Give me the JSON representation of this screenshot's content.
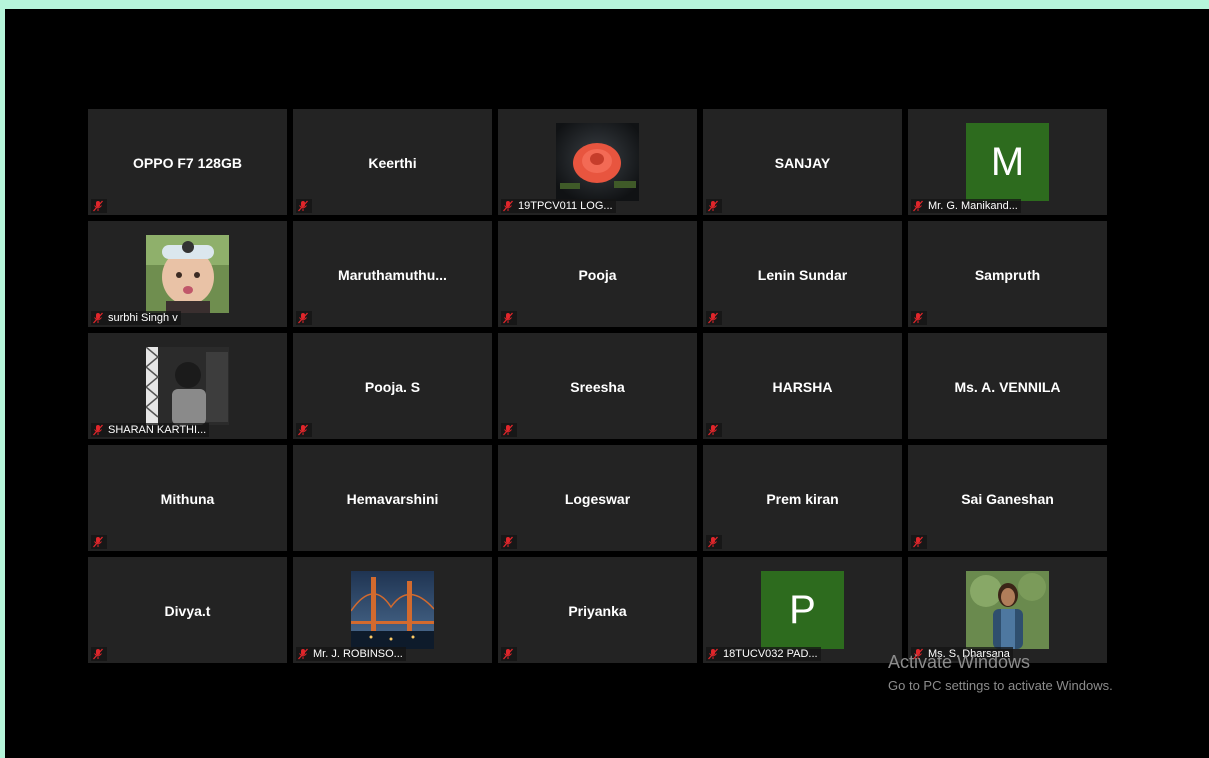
{
  "meeting": {
    "tiles": [
      {
        "name": "OPPO F7 128GB",
        "label": "",
        "avatar": "none",
        "muted": true
      },
      {
        "name": "Keerthi",
        "label": "",
        "avatar": "none",
        "muted": true
      },
      {
        "name": "",
        "label": "19TPCV011 LOG...",
        "avatar": "rose-photo",
        "muted": true
      },
      {
        "name": "SANJAY",
        "label": "",
        "avatar": "none",
        "muted": true
      },
      {
        "name": "",
        "label": "Mr. G. Manikand...",
        "avatar": "letter",
        "letter": "M",
        "avatar_color": "#2d6b1e",
        "muted": true
      },
      {
        "name": "",
        "label": "surbhi Singh v",
        "avatar": "baby-photo",
        "muted": true
      },
      {
        "name": "Maruthamuthu...",
        "label": "",
        "avatar": "none",
        "muted": true
      },
      {
        "name": "Pooja",
        "label": "",
        "avatar": "none",
        "muted": true
      },
      {
        "name": "Lenin Sundar",
        "label": "",
        "avatar": "none",
        "muted": true
      },
      {
        "name": "Sampruth",
        "label": "",
        "avatar": "none",
        "muted": true
      },
      {
        "name": "",
        "label": "SHARAN KARTHI...",
        "avatar": "bw-photo",
        "muted": true
      },
      {
        "name": "Pooja. S",
        "label": "",
        "avatar": "none",
        "muted": true
      },
      {
        "name": "Sreesha",
        "label": "",
        "avatar": "none",
        "muted": true
      },
      {
        "name": "HARSHA",
        "label": "",
        "avatar": "none",
        "muted": true
      },
      {
        "name": "Ms. A. VENNILA",
        "label": "",
        "avatar": "none",
        "muted": false
      },
      {
        "name": "Mithuna",
        "label": "",
        "avatar": "none",
        "muted": true
      },
      {
        "name": "Hemavarshini",
        "label": "",
        "avatar": "none",
        "muted": false
      },
      {
        "name": "Logeswar",
        "label": "",
        "avatar": "none",
        "muted": true
      },
      {
        "name": "Prem kiran",
        "label": "",
        "avatar": "none",
        "muted": true
      },
      {
        "name": "Sai Ganeshan",
        "label": "",
        "avatar": "none",
        "muted": true
      },
      {
        "name": "Divya.t",
        "label": "",
        "avatar": "none",
        "muted": true
      },
      {
        "name": "",
        "label": "Mr. J. ROBINSO...",
        "avatar": "bridge-photo",
        "muted": true
      },
      {
        "name": "Priyanka",
        "label": "",
        "avatar": "none",
        "muted": true
      },
      {
        "name": "",
        "label": "18TUCV032 PAD...",
        "avatar": "letter",
        "letter": "P",
        "avatar_color": "#2d6b1e",
        "muted": true
      },
      {
        "name": "",
        "label": "Ms. S. Dharsana",
        "avatar": "woman-photo",
        "muted": true
      }
    ]
  },
  "watermark": {
    "title": "Activate Windows",
    "subtitle": "Go to PC settings to activate Windows."
  },
  "colors": {
    "tile_bg": "#232323",
    "muted_icon": "#e0262b",
    "outer_border": "#b6f5db"
  }
}
